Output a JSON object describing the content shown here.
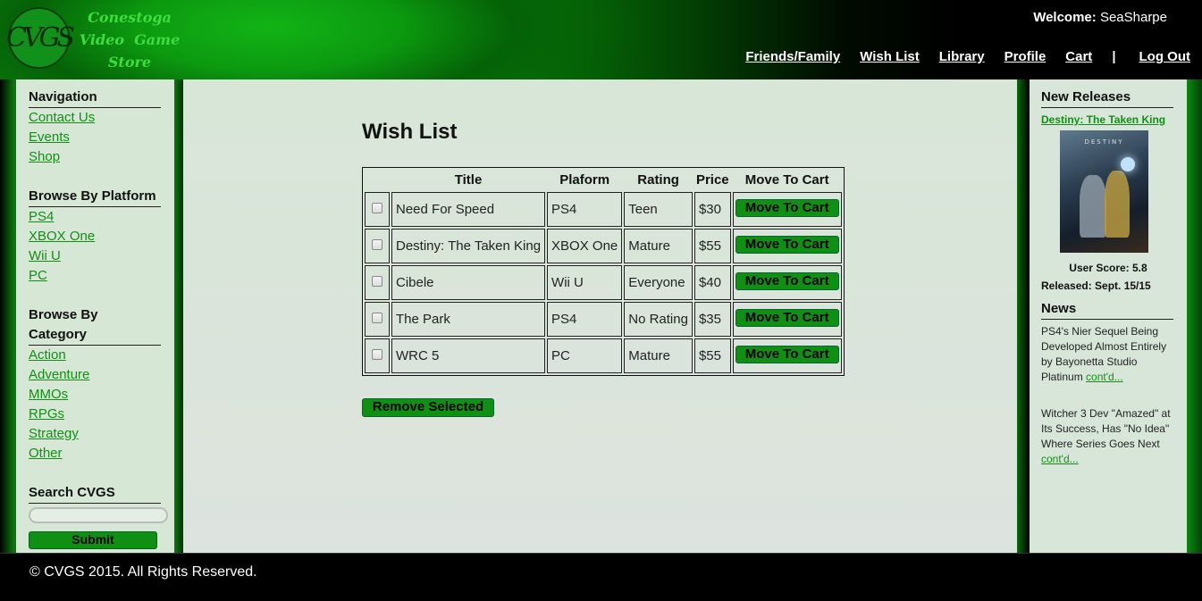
{
  "brand": {
    "logo_mark": "CVGS",
    "name_lines": [
      "Conestoga",
      "Video  Game",
      "Store"
    ]
  },
  "header": {
    "welcome_label": "Welcome:",
    "username": "SeaSharpe",
    "nav": [
      "Friends/Family",
      "Wish List",
      "Library",
      "Profile",
      "Cart"
    ],
    "separator": "|",
    "logout": "Log Out"
  },
  "sidebar": {
    "navigation_title": "Navigation",
    "navigation": [
      "Contact Us",
      "Events",
      "Shop"
    ],
    "platform_title": "Browse By Platform",
    "platforms": [
      "PS4",
      "XBOX One",
      "Wii U",
      "PC"
    ],
    "category_title": "Browse By Category",
    "categories": [
      "Action",
      "Adventure",
      "MMOs",
      "RPGs",
      "Strategy",
      "Other"
    ],
    "search_title": "Search CVGS",
    "search_value": "",
    "submit_label": "Submit"
  },
  "main": {
    "title": "Wish List",
    "columns": [
      "Title",
      "Plaform",
      "Rating",
      "Price",
      "Move To Cart"
    ],
    "rows": [
      {
        "title": "Need For Speed",
        "platform": "PS4",
        "rating": "Teen",
        "price": "$30",
        "action": "Move To Cart"
      },
      {
        "title": "Destiny: The Taken King",
        "platform": "XBOX One",
        "rating": "Mature",
        "price": "$55",
        "action": "Move To Cart"
      },
      {
        "title": "Cibele",
        "platform": "Wii U",
        "rating": "Everyone",
        "price": "$40",
        "action": "Move To Cart"
      },
      {
        "title": "The Park",
        "platform": "PS4",
        "rating": "No Rating",
        "price": "$35",
        "action": "Move To Cart"
      },
      {
        "title": "WRC 5",
        "platform": "PC",
        "rating": "Mature",
        "price": "$55",
        "action": "Move To Cart"
      }
    ],
    "remove_label": "Remove Selected"
  },
  "right_sidebar": {
    "new_releases_title": "New Releases",
    "featured_title": "Destiny: The Taken King",
    "cover_text": "DESTINY",
    "user_score": "User Score: 5.8",
    "released": "Released: Sept. 15/15",
    "news_title": "News",
    "news": [
      {
        "text": "PS4's Nier Sequel Being Developed Almost Entirely by Bayonetta Studio Platinum",
        "link": "cont'd..."
      },
      {
        "text": "Witcher 3 Dev \"Amazed\" at Its Success, Has \"No Idea\" Where Series Goes Next",
        "link": "cont'd..."
      }
    ]
  },
  "footer": {
    "copyright": "© CVGS 2015. All Rights Reserved."
  },
  "colors": {
    "accent_green": "#109012",
    "panel_bg": "#d6e7d6",
    "header_green": "#0ca010"
  }
}
